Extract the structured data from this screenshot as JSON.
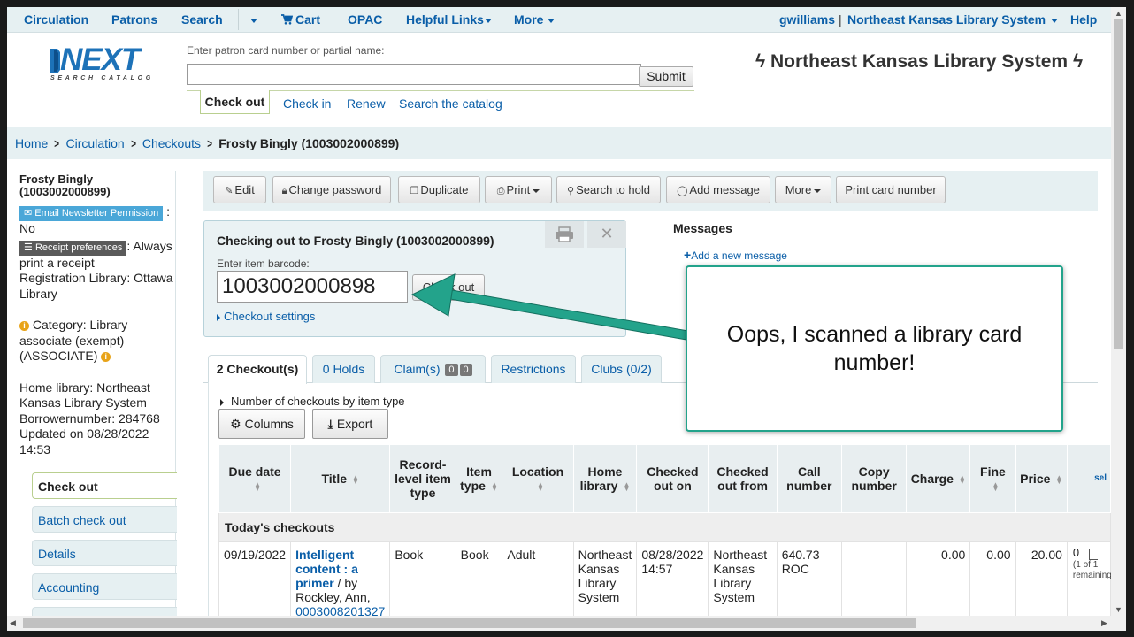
{
  "topnav": {
    "circulation": "Circulation",
    "patrons": "Patrons",
    "search": "Search",
    "cart": "Cart",
    "opac": "OPAC",
    "helpful_links": "Helpful Links",
    "more": "More",
    "user": "gwilliams",
    "separator": "|",
    "library": "Northeast Kansas Library System",
    "help": "Help"
  },
  "header": {
    "logo_text": "NEXT",
    "logo_subtext": "SEARCH CATALOG",
    "patron_label": "Enter patron card number or partial name:",
    "patron_value": "",
    "submit_label": "Submit",
    "tabs": [
      "Check out",
      "Check in",
      "Renew",
      "Search the catalog"
    ],
    "library_title": "Northeast Kansas Library System",
    "bolt": "ϟ"
  },
  "breadcrumb": {
    "home": "Home",
    "circulation": "Circulation",
    "checkouts": "Checkouts",
    "current": "Frosty Bingly (1003002000899)"
  },
  "sidebar": {
    "patron_name": "Frosty Bingly",
    "patron_card": "(1003002000899)",
    "email_tag": "Email Newsletter Permission",
    "email_value": "No",
    "receipt_tag": "Receipt preferences",
    "receipt_value": ": Always print a receipt",
    "registration": "Registration Library: Ottawa Library",
    "category": "Category: Library associate (exempt) (ASSOCIATE)",
    "home_library": "Home library: Northeast Kansas Library System",
    "borrowernumber": "Borrowernumber: 284768",
    "updated": "Updated on 08/28/2022 14:53",
    "nav": [
      "Check out",
      "Batch check out",
      "Details",
      "Accounting"
    ]
  },
  "toolbar": {
    "edit": "Edit",
    "change_password": "Change password",
    "duplicate": "Duplicate",
    "print": "Print",
    "search_to_hold": "Search to hold",
    "add_message": "Add message",
    "more": "More",
    "print_card_number": "Print card number"
  },
  "checkout_box": {
    "title": "Checking out to Frosty Bingly (1003002000899)",
    "barcode_label": "Enter item barcode:",
    "barcode_value": "1003002000898",
    "button_label": "Check out",
    "settings_link": "Checkout settings"
  },
  "messages": {
    "heading": "Messages",
    "add_link": "Add a new message"
  },
  "tabs": {
    "checkouts": "2 Checkout(s)",
    "holds": "0 Holds",
    "claims": "Claim(s)",
    "claims_badge_1": "0",
    "claims_badge_2": "0",
    "restrictions": "Restrictions",
    "clubs": "Clubs (0/2)"
  },
  "table_controls": {
    "num_by_type": "Number of checkouts by item type",
    "columns": "Columns",
    "export": "Export"
  },
  "table": {
    "headers": [
      "Due date",
      "Title",
      "Record-level item type",
      "Item type",
      "Location",
      "Home library",
      "Checked out on",
      "Checked out from",
      "Call number",
      "Copy number",
      "Charge",
      "Fine",
      "Price",
      "sel"
    ],
    "group_label": "Today's checkouts",
    "row": {
      "due": "09/19/2022",
      "title": "Intelligent content : a primer",
      "by": " / by Rockley, Ann,",
      "barcode": "0003008201327",
      "record_type": "Book",
      "item_type": "Book",
      "location": "Adult",
      "home_library": "Northeast Kansas Library System",
      "checked_out_on": "08/28/2022 14:57",
      "checked_out_from": "Northeast Kansas Library System",
      "call_number": "640.73 ROC",
      "copy_number": "",
      "charge": "0.00",
      "fine": "0.00",
      "price": "20.00",
      "renew_count": "0",
      "renew_note": "(1 of 1 remaining)"
    }
  },
  "callout": {
    "text": "Oops, I scanned a library card number!"
  },
  "colors": {
    "link": "#0a5ea8",
    "header_bg": "#e6f0f2",
    "callout_border": "#23a38b",
    "arrow": "#23a38b"
  }
}
